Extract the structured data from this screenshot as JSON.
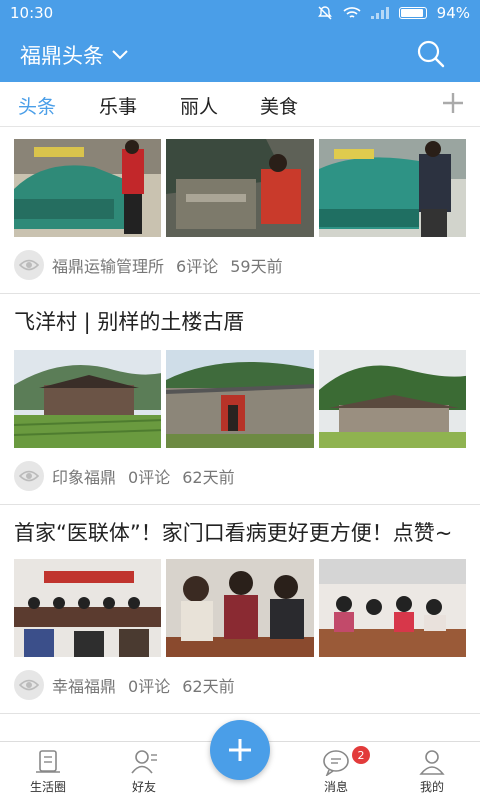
{
  "status": {
    "time": "10:30",
    "battery": "94%",
    "battery_level": 0.94
  },
  "header": {
    "title": "福鼎头条"
  },
  "tabs": [
    {
      "label": "头条"
    },
    {
      "label": "乐事"
    },
    {
      "label": "丽人"
    },
    {
      "label": "美食"
    }
  ],
  "articles": [
    {
      "title": "",
      "source": "福鼎运输管理所",
      "comments": "6评论",
      "time": "59天前"
    },
    {
      "title": "飞洋村 | 别样的土楼古厝",
      "source": "印象福鼎",
      "comments": "0评论",
      "time": "62天前"
    },
    {
      "title": "首家“医联体”！家门口看病更好更方便！点赞~",
      "source": "幸福福鼎",
      "comments": "0评论",
      "time": "62天前"
    }
  ],
  "bottom_nav": [
    {
      "label": "生活圈"
    },
    {
      "label": "好友"
    },
    {
      "label": "消息"
    },
    {
      "label": "我的"
    }
  ],
  "badge_count": "2",
  "colors": {
    "accent": "#4a9ee8",
    "badge": "#e23b3b"
  }
}
